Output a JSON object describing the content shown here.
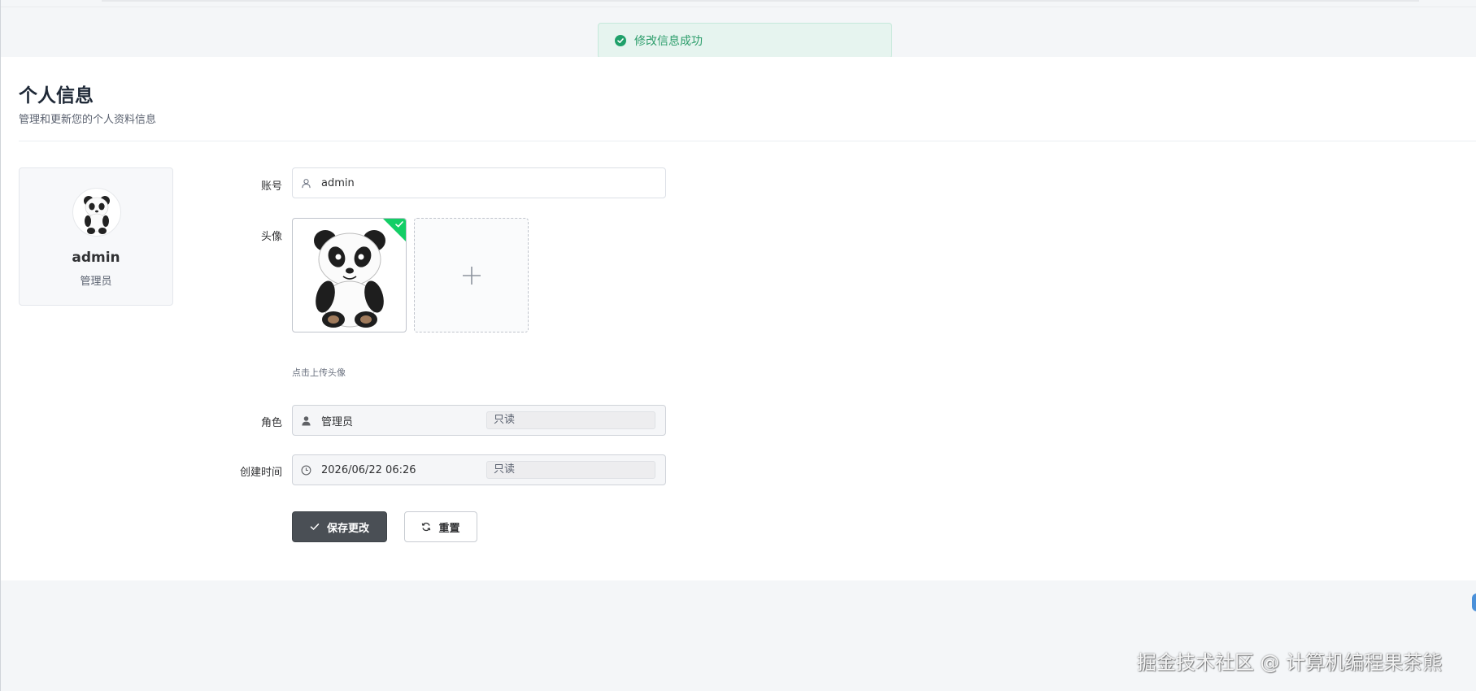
{
  "toast": {
    "message": "修改信息成功",
    "color": "#1fa06a"
  },
  "header": {
    "title": "个人信息",
    "subtitle": "管理和更新您的个人资料信息"
  },
  "profile": {
    "name": "admin",
    "role": "管理员"
  },
  "form": {
    "account": {
      "label": "账号",
      "value": "admin",
      "icon": "user-outline-icon"
    },
    "avatar": {
      "label": "头像",
      "hint": "点击上传头像"
    },
    "role": {
      "label": "角色",
      "value": "管理员",
      "readonly_tag": "只读",
      "icon": "user-solid-icon"
    },
    "created_at": {
      "label": "创建时间",
      "value": "2026/06/22 06:26",
      "readonly_tag": "只读",
      "icon": "clock-icon"
    }
  },
  "buttons": {
    "save_label": "保存更改",
    "reset_label": "重置"
  },
  "watermark": "掘金技术社区 @ 计算机编程果茶熊",
  "colors": {
    "accent_dark": "#4a4f55",
    "success": "#13ce66"
  }
}
